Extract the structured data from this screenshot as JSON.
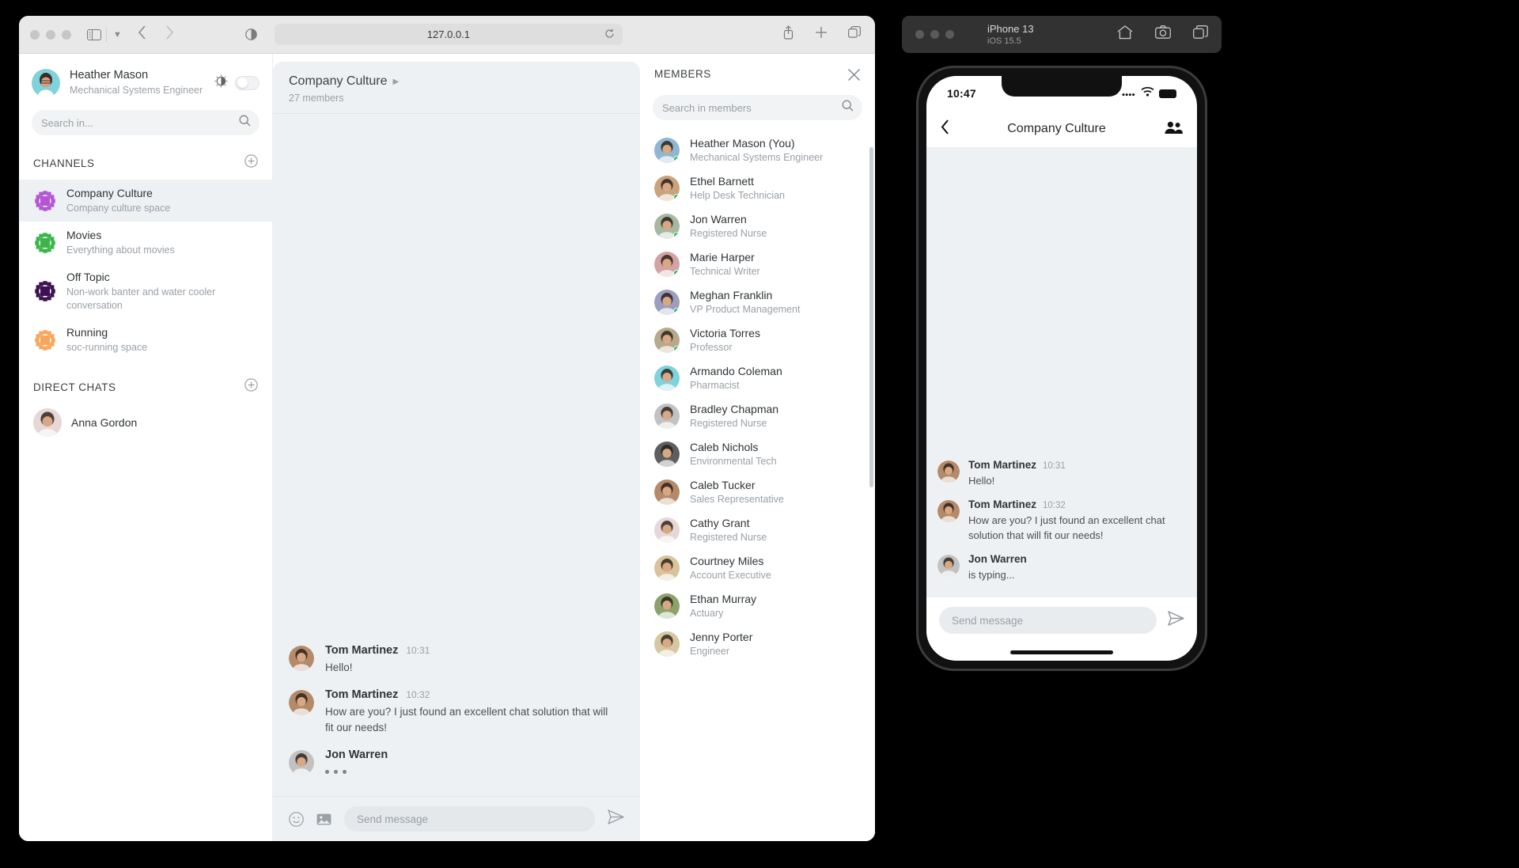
{
  "browser": {
    "url": "127.0.0.1",
    "icons": {
      "sidebar": "sidebar-icon",
      "dropdown": "chevron-down-icon",
      "back": "back-arrow-icon",
      "forward": "forward-arrow-icon",
      "shield": "reader-icon",
      "reload": "reload-icon",
      "share": "share-icon",
      "new_tab": "plus-icon",
      "tabs": "tabs-icon"
    }
  },
  "sidebar": {
    "user": {
      "name": "Heather Mason",
      "role": "Mechanical Systems Engineer"
    },
    "theme_toggle_label": "theme-toggle",
    "search": {
      "placeholder": "Search in...",
      "value": ""
    },
    "channels_header": "CHANNELS",
    "channels": [
      {
        "name": "Company Culture",
        "desc": "Company culture space",
        "color": "#b455d6",
        "active": true
      },
      {
        "name": "Movies",
        "desc": "Everything about movies",
        "color": "#3bb54a",
        "active": false
      },
      {
        "name": "Off Topic",
        "desc": "Non-work banter and water cooler conversation",
        "color": "#3d1152",
        "active": false
      },
      {
        "name": "Running",
        "desc": "soc-running space",
        "color": "#f9a65a",
        "active": false
      }
    ],
    "direct_header": "DIRECT CHATS",
    "direct_chats": [
      {
        "name": "Anna Gordon"
      }
    ]
  },
  "chat": {
    "title": "Company Culture",
    "subtitle": "27 members",
    "messages": [
      {
        "author": "Tom Martinez",
        "time": "10:31",
        "text": "Hello!",
        "typing": false
      },
      {
        "author": "Tom Martinez",
        "time": "10:32",
        "text": "How are you? I just found an excellent chat solution that will fit our needs!",
        "typing": false
      },
      {
        "author": "Jon Warren",
        "time": "",
        "text": "",
        "typing": true
      }
    ],
    "composer": {
      "placeholder": "Send message",
      "value": ""
    }
  },
  "members_panel": {
    "title": "MEMBERS",
    "search": {
      "placeholder": "Search in members",
      "value": ""
    },
    "members": [
      {
        "name": "Heather Mason (You)",
        "role": "Mechanical Systems Engineer",
        "online": true
      },
      {
        "name": "Ethel Barnett",
        "role": "Help Desk Technician",
        "online": true
      },
      {
        "name": "Jon Warren",
        "role": "Registered Nurse",
        "online": true
      },
      {
        "name": "Marie Harper",
        "role": "Technical Writer",
        "online": true
      },
      {
        "name": "Meghan Franklin",
        "role": "VP Product Management",
        "online": true
      },
      {
        "name": "Victoria Torres",
        "role": "Professor",
        "online": true
      },
      {
        "name": "Armando Coleman",
        "role": "Pharmacist",
        "online": false
      },
      {
        "name": "Bradley Chapman",
        "role": "Registered Nurse",
        "online": false
      },
      {
        "name": "Caleb Nichols",
        "role": "Environmental Tech",
        "online": false
      },
      {
        "name": "Caleb Tucker",
        "role": "Sales Representative",
        "online": false
      },
      {
        "name": "Cathy Grant",
        "role": "Registered Nurse",
        "online": false
      },
      {
        "name": "Courtney Miles",
        "role": "Account Executive",
        "online": false
      },
      {
        "name": "Ethan Murray",
        "role": "Actuary",
        "online": false
      },
      {
        "name": "Jenny Porter",
        "role": "Engineer",
        "online": false
      }
    ]
  },
  "simulator": {
    "device": "iPhone 13",
    "os": "iOS 15.5",
    "status_time": "10:47",
    "nav_title": "Company Culture",
    "messages": [
      {
        "author": "Tom Martinez",
        "time": "10:31",
        "text": "Hello!",
        "typing": false
      },
      {
        "author": "Tom Martinez",
        "time": "10:32",
        "text": "How are you? I just found an excellent chat solution that will fit our needs!",
        "typing": false
      },
      {
        "author": "Jon Warren",
        "time": "",
        "text": "is typing...",
        "typing": false
      }
    ],
    "composer": {
      "placeholder": "Send message",
      "value": ""
    }
  },
  "colors": {
    "accent_green": "#1DB954",
    "panel_bg": "#eef1f3",
    "muted": "#9aa0a6"
  }
}
